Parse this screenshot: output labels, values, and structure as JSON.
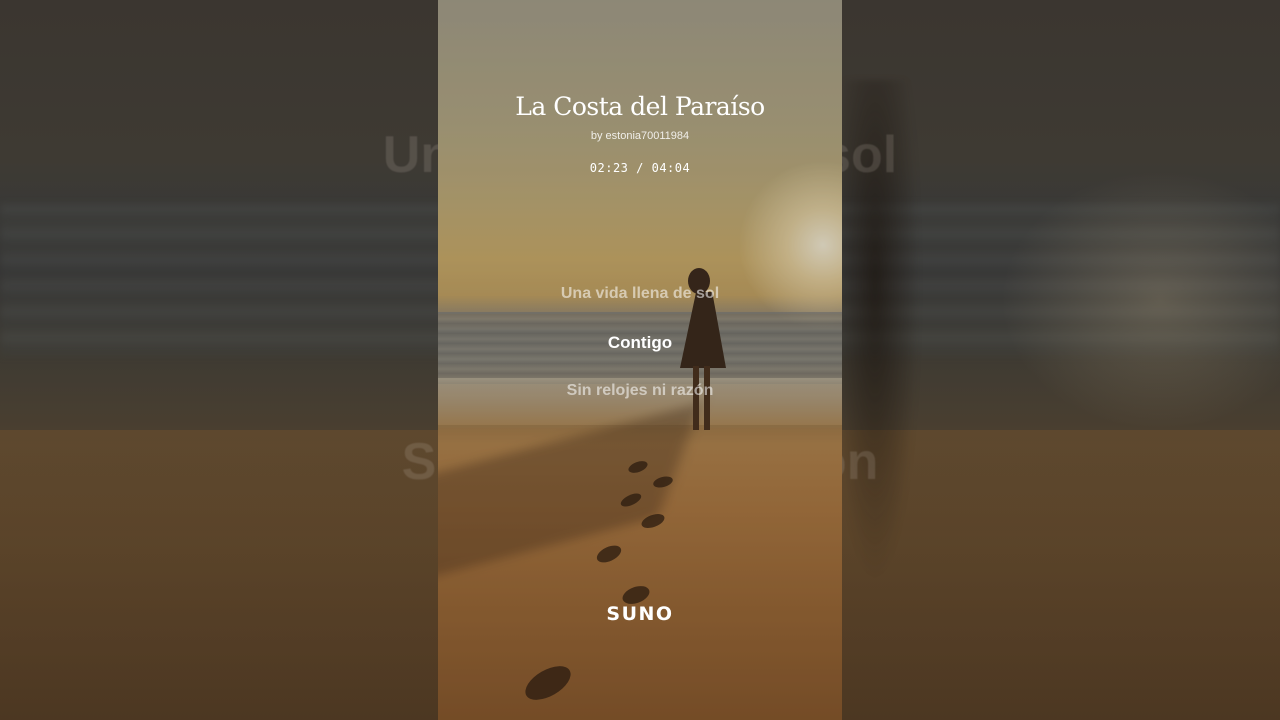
{
  "song": {
    "title": "La Costa del Paraíso",
    "artist": "by estonia70011984",
    "elapsed": "02:23",
    "separator": "/",
    "duration": "04:04",
    "progress_fraction": 0.586
  },
  "lyrics": {
    "previous": "Una vida llena de sol",
    "current": "Contigo",
    "next": "Sin relojes ni razón"
  },
  "background_lyrics": {
    "top": "Una vida llena de sol",
    "bottom": "Sin relojes ni razón"
  },
  "brand": {
    "logo_text": "SUNO"
  },
  "colors": {
    "text_primary": "#ffffff",
    "text_dimmed": "rgba(255,255,255,0.55)"
  }
}
